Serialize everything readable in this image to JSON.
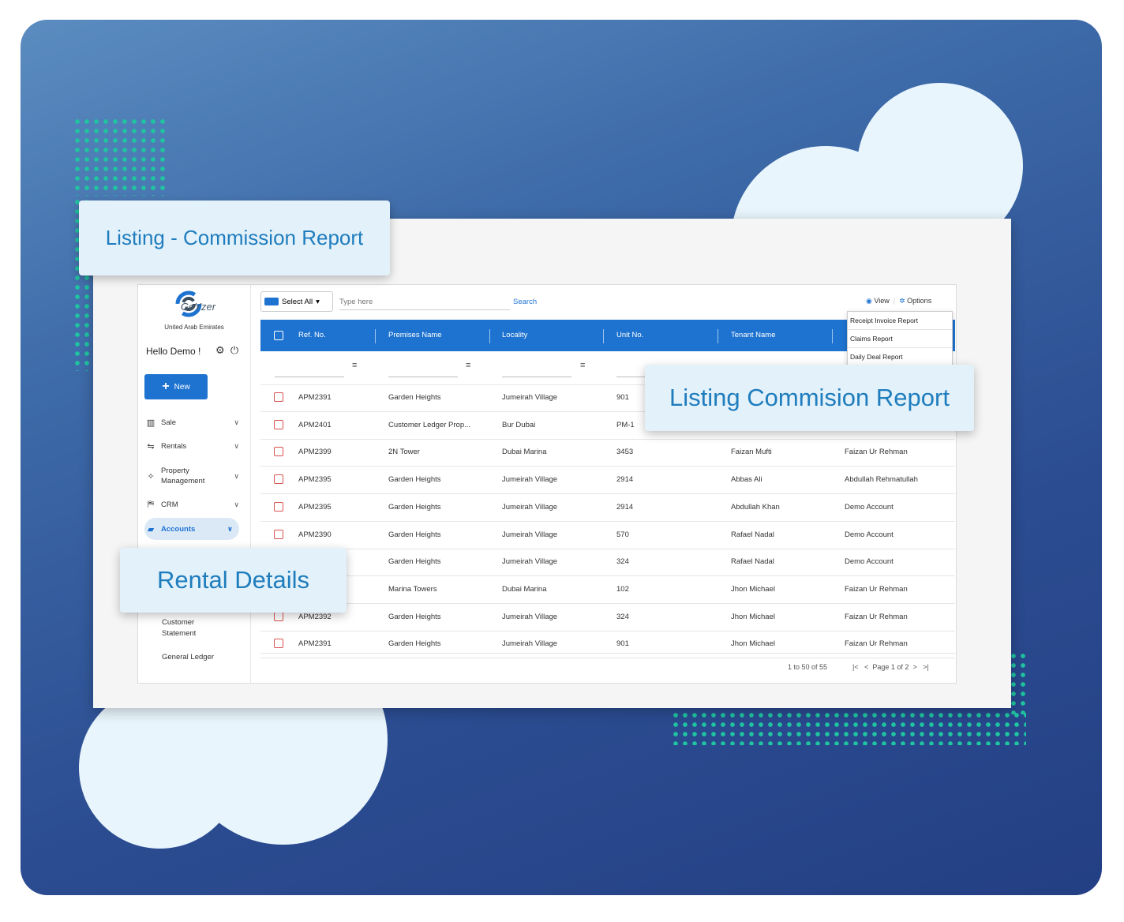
{
  "callouts": {
    "listing_commission": "Listing - Commission Report",
    "listing_commision": "Listing Commision Report",
    "rental_details": "Rental Details"
  },
  "app": {
    "logo_text": "GoYzer",
    "country": "United Arab Emirates",
    "greeting": "Hello Demo !",
    "new_button": "New",
    "nav": [
      {
        "label": "Sale",
        "icon": "bar-chart-icon"
      },
      {
        "label": "Rentals",
        "icon": "handshake-icon"
      },
      {
        "label": "Property Management",
        "icon": "wrench-icon"
      },
      {
        "label": "CRM",
        "icon": "crm-icon"
      },
      {
        "label": "Accounts",
        "icon": "folder-icon",
        "active": true
      }
    ],
    "sub_nav": [
      "Customer Statement",
      "General Ledger"
    ]
  },
  "toolbar": {
    "select_all": "Select All",
    "search_placeholder": "Type here",
    "search_button": "Search",
    "view": "View",
    "options": "Options"
  },
  "options_menu": [
    "Receipt Invoice Report",
    "Claims Report",
    "Daily Deal Report"
  ],
  "table": {
    "columns": [
      "Ref. No.",
      "Premises Name",
      "Locality",
      "Unit No.",
      "Tenant Name"
    ],
    "rows": [
      [
        "APM2391",
        "Garden Heights",
        "Jumeirah Village",
        "901",
        "",
        ""
      ],
      [
        "APM2401",
        "Customer Ledger Prop...",
        "Bur Dubai",
        "PM-1",
        "",
        ""
      ],
      [
        "APM2399",
        "2N Tower",
        "Dubai Marina",
        "3453",
        "Faizan Mufti",
        "Faizan Ur Rehman"
      ],
      [
        "APM2395",
        "Garden Heights",
        "Jumeirah Village",
        "2914",
        "Abbas Ali",
        "Abdullah Rehmatullah"
      ],
      [
        "APM2395",
        "Garden Heights",
        "Jumeirah Village",
        "2914",
        "Abdullah Khan",
        "Demo Account"
      ],
      [
        "APM2390",
        "Garden Heights",
        "Jumeirah Village",
        "570",
        "Rafael Nadal",
        "Demo Account"
      ],
      [
        "",
        "Garden Heights",
        "Jumeirah Village",
        "324",
        "Rafael Nadal",
        "Demo Account"
      ],
      [
        "",
        "Marina Towers",
        "Dubai Marina",
        "102",
        "Jhon Michael",
        "Faizan Ur Rehman"
      ],
      [
        "APM2392",
        "Garden Heights",
        "Jumeirah Village",
        "324",
        "Jhon Michael",
        "Faizan Ur Rehman"
      ],
      [
        "APM2391",
        "Garden Heights",
        "Jumeirah Village",
        "901",
        "Jhon Michael",
        "Faizan Ur Rehman"
      ]
    ]
  },
  "pagination": {
    "count": "1 to 50 of 55",
    "page": "Page 1 of 2"
  },
  "colors": {
    "accent": "#1e73d0",
    "checkbox": "#d9534f",
    "teal_dots": "#1fc4a0"
  }
}
